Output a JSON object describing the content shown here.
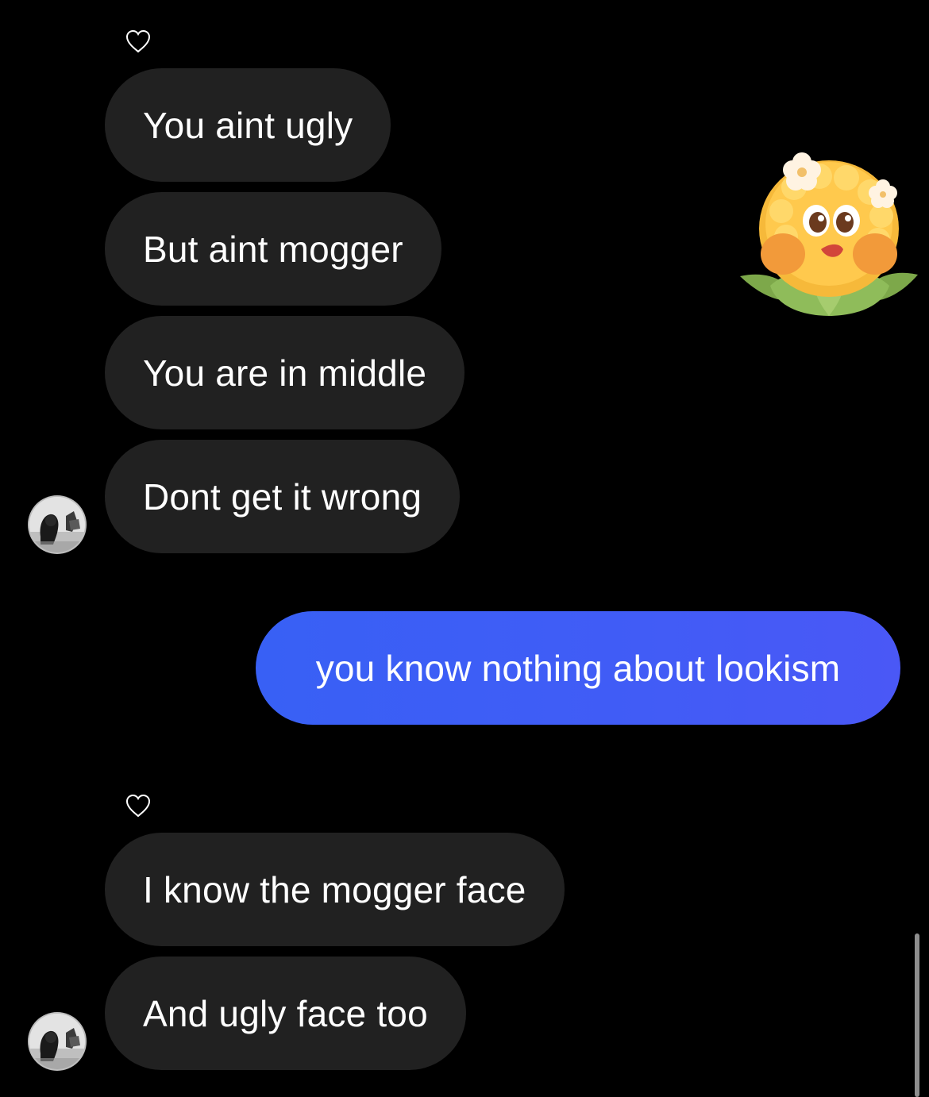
{
  "messages": {
    "group1": [
      {
        "text": "You aint ugly"
      },
      {
        "text": "But aint mogger"
      },
      {
        "text": "You are in middle"
      },
      {
        "text": "Dont get it wrong"
      }
    ],
    "sent": [
      {
        "text": "you know nothing about lookism"
      }
    ],
    "group2": [
      {
        "text": "I know the mogger face"
      },
      {
        "text": "And ugly face too"
      }
    ]
  },
  "colors": {
    "background": "#000000",
    "incoming_bubble": "#212121",
    "outgoing_bubble": "#3f5ef6",
    "text": "#ffffff"
  },
  "icons": {
    "reaction": "heart-outline-icon",
    "sticker": "corn-character-sticker",
    "avatar": "contact-avatar"
  }
}
